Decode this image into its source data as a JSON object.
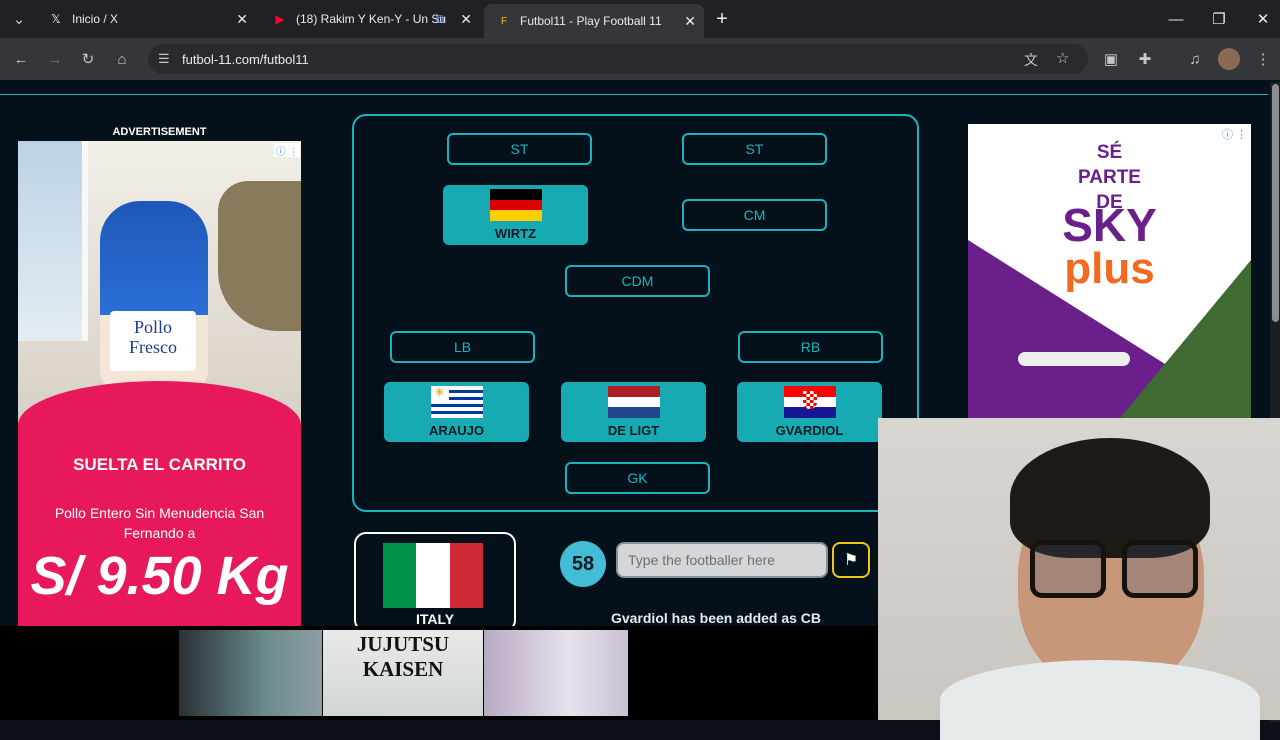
{
  "browser": {
    "tabs": [
      {
        "title": "Inicio / X",
        "icon": "x-logo-icon",
        "active": false
      },
      {
        "title": "(18) Rakim Y Ken-Y - Un Su",
        "icon": "youtube-icon",
        "active": false
      },
      {
        "title": "Futbol11 - Play Football 11",
        "icon": "futbol11-icon",
        "active": true
      }
    ],
    "url": "futbol-11.com/futbol11"
  },
  "ads": {
    "label": "ADVERTISEMENT",
    "left": {
      "bag_brand": "Pollo Fresco",
      "slogan": "SUELTA EL CARRITO",
      "description": "Pollo Entero Sin Menudencia San Fernando a",
      "price": "S/ 9.50 Kg"
    },
    "right": {
      "headline": "SÉ PARTE DE",
      "brand_top": "SKY",
      "brand_bottom": "plus"
    }
  },
  "formation": {
    "slots": {
      "st_left": "ST",
      "st_right": "ST",
      "cm": "CM",
      "cdm": "CDM",
      "lb": "LB",
      "rb": "RB",
      "gk": "GK"
    },
    "players": {
      "cam_left": {
        "name": "WIRTZ",
        "country": "Germany"
      },
      "cb_left": {
        "name": "ARAUJO",
        "country": "Uruguay"
      },
      "cb_center": {
        "name": "DE LIGT",
        "country": "Netherlands"
      },
      "cb_right": {
        "name": "GVARDIOL",
        "country": "Croatia"
      }
    }
  },
  "game": {
    "country": "ITALY",
    "score": "58",
    "input_placeholder": "Type the footballer here",
    "status": "Gvardiol has been added as CB"
  },
  "thumbnails": {
    "middle_title": "JUJUTSU KAISEN"
  },
  "colors": {
    "accent": "#19b5bf",
    "page_bg": "#04111a",
    "score_bg": "#43bcd6",
    "flag_button_border": "#f0c419"
  }
}
